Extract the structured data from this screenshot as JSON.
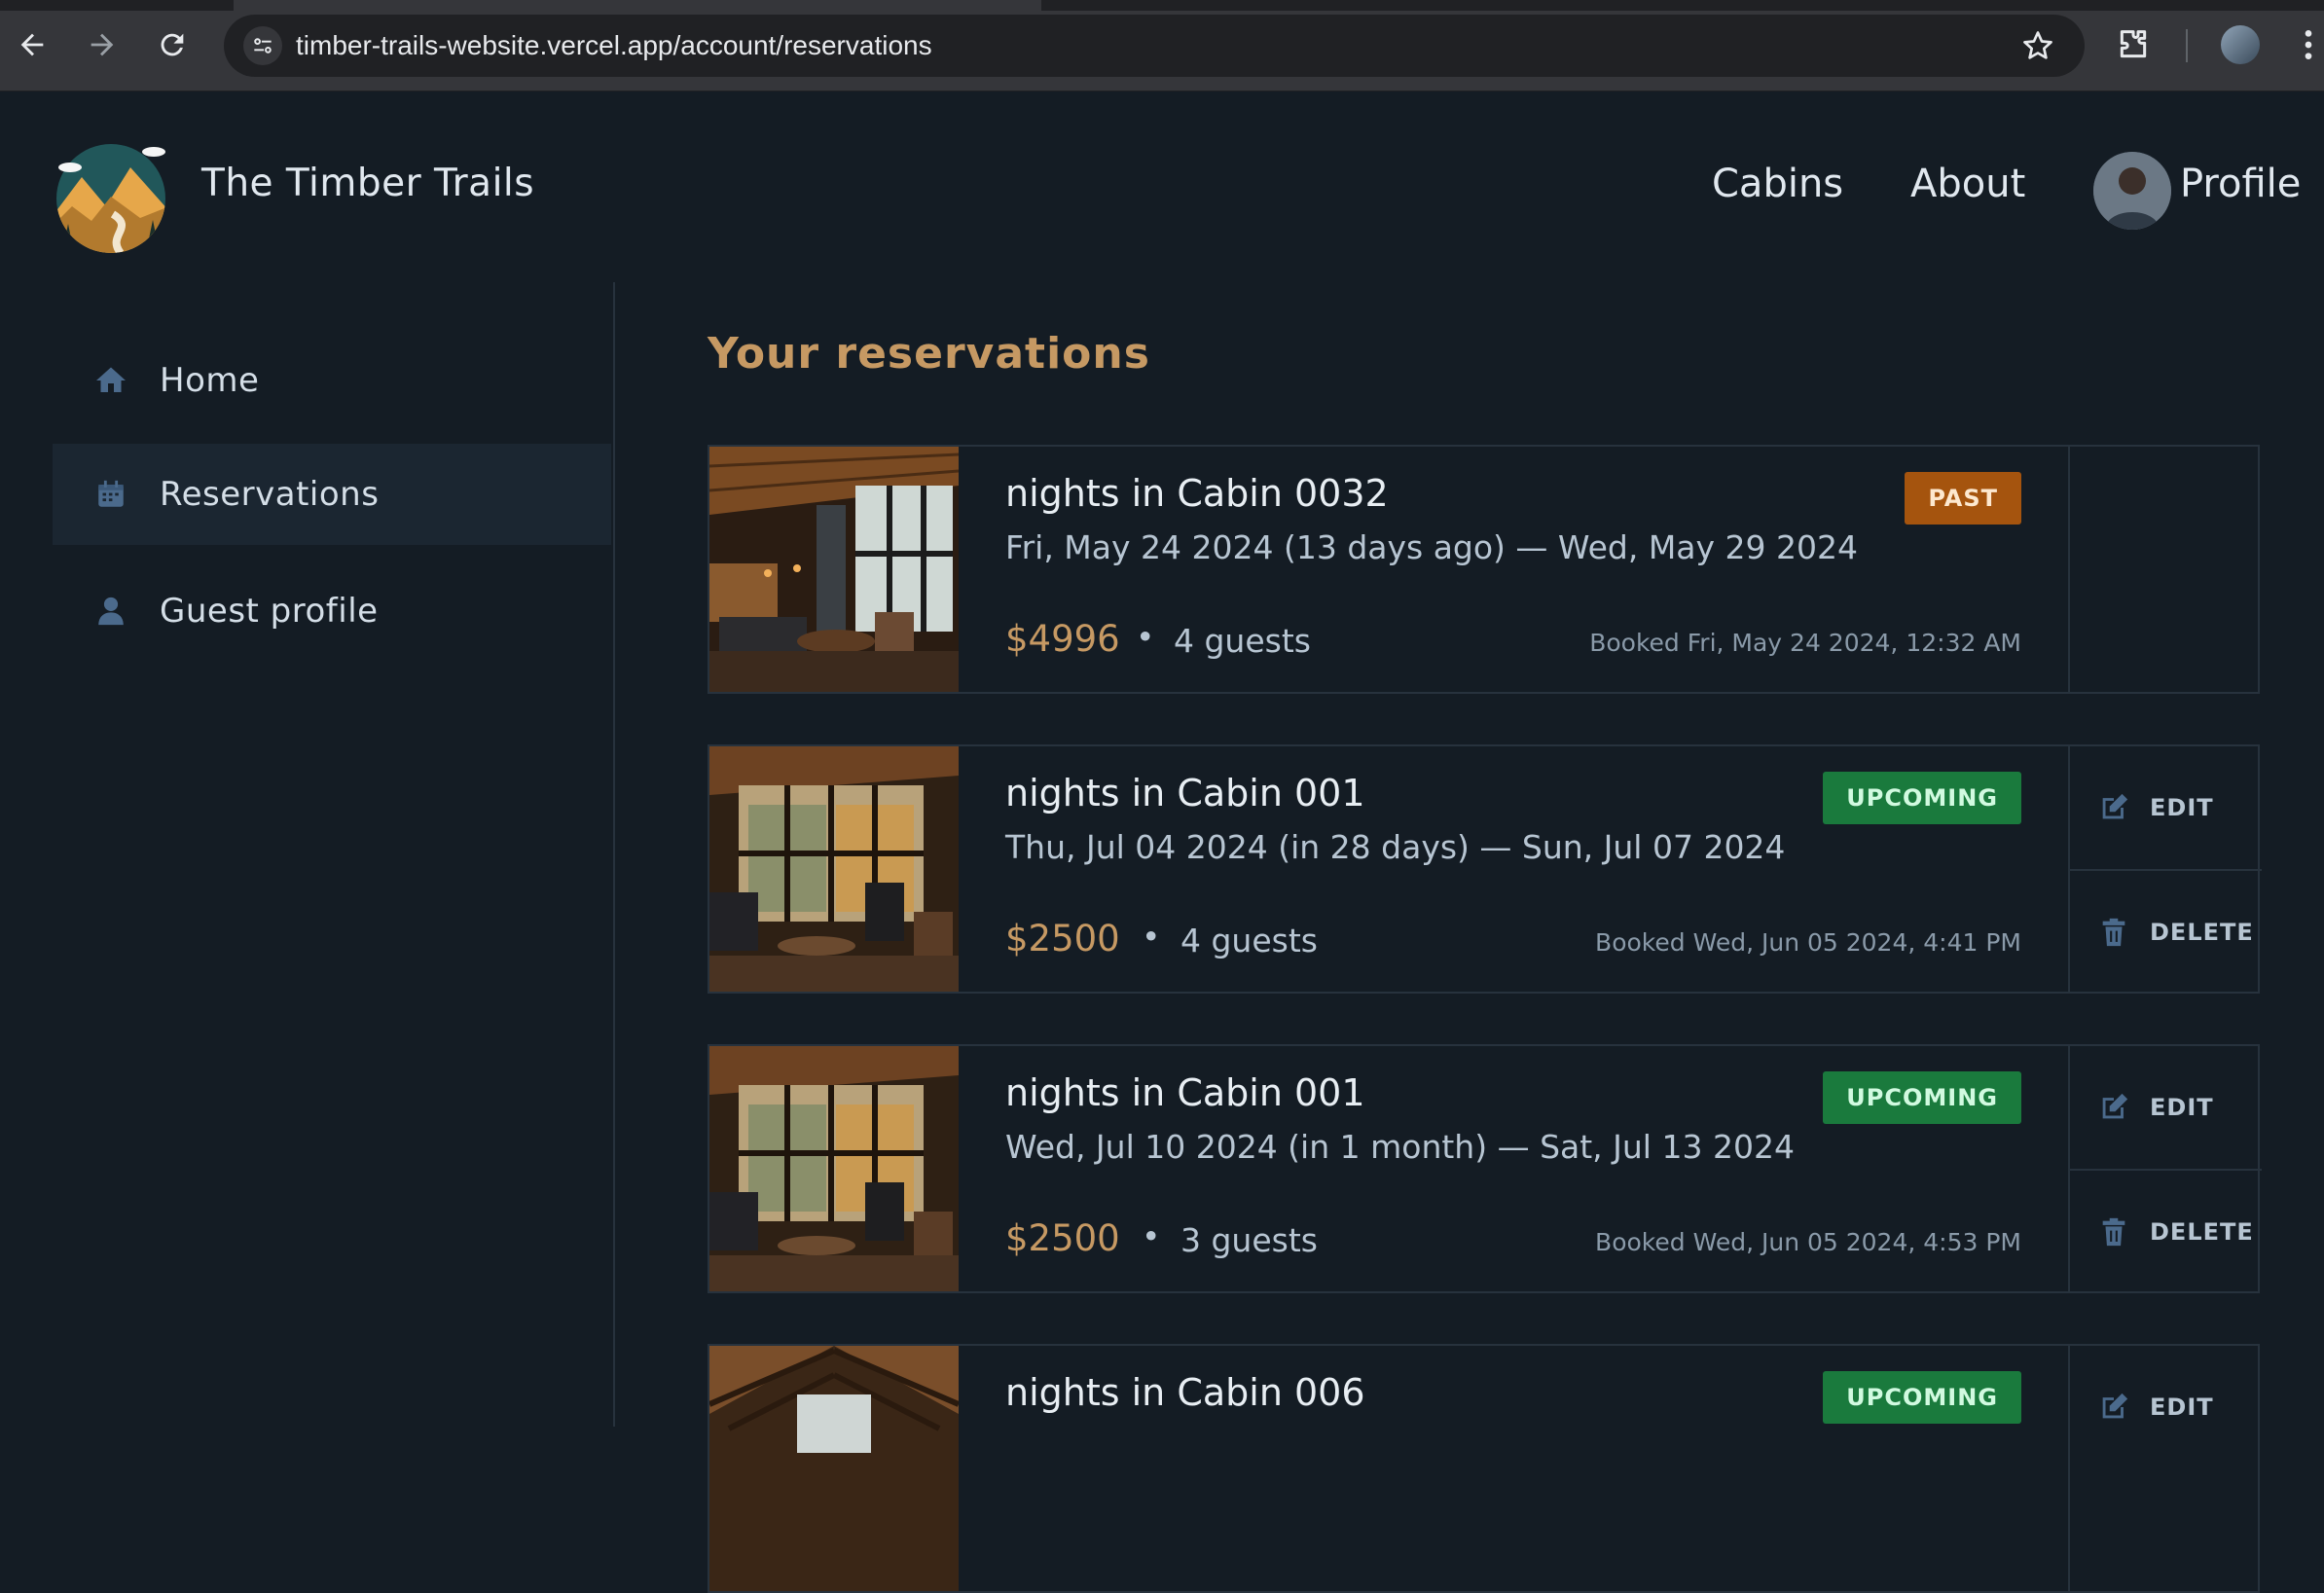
{
  "browser": {
    "url": "timber-trails-website.vercel.app/account/reservations"
  },
  "header": {
    "brand": "The Timber Trails",
    "nav": {
      "cabins": "Cabins",
      "about": "About",
      "profile": "Profile"
    }
  },
  "sidebar": {
    "items": [
      {
        "label": "Home",
        "icon": "home-icon"
      },
      {
        "label": "Reservations",
        "icon": "calendar-icon"
      },
      {
        "label": "Guest profile",
        "icon": "user-icon"
      }
    ]
  },
  "main": {
    "title": "Your reservations",
    "reservations": [
      {
        "title": "nights in Cabin 0032",
        "status": "PAST",
        "dates": "Fri, May 24 2024 (13 days ago) — Wed, May 29 2024",
        "price": "$4996",
        "guests": "4 guests",
        "booked": "Booked Fri, May 24 2024, 12:32 AM"
      },
      {
        "title": "nights in Cabin 001",
        "status": "UPCOMING",
        "dates": "Thu, Jul 04 2024 (in 28 days) — Sun, Jul 07 2024",
        "price": "$2500",
        "guests": "4 guests",
        "booked": "Booked Wed, Jun 05 2024, 4:41 PM",
        "edit": "EDIT",
        "delete": "DELETE"
      },
      {
        "title": "nights in Cabin 001",
        "status": "UPCOMING",
        "dates": "Wed, Jul 10 2024 (in 1 month) — Sat, Jul 13 2024",
        "price": "$2500",
        "guests": "3 guests",
        "booked": "Booked Wed, Jun 05 2024, 4:53 PM",
        "edit": "EDIT",
        "delete": "DELETE"
      },
      {
        "title": "nights in Cabin 006",
        "status": "UPCOMING",
        "edit": "EDIT"
      }
    ]
  },
  "colors": {
    "accent": "#c69963",
    "background": "#141c24",
    "past": "#a5540e",
    "upcoming": "#1a7a3d"
  }
}
